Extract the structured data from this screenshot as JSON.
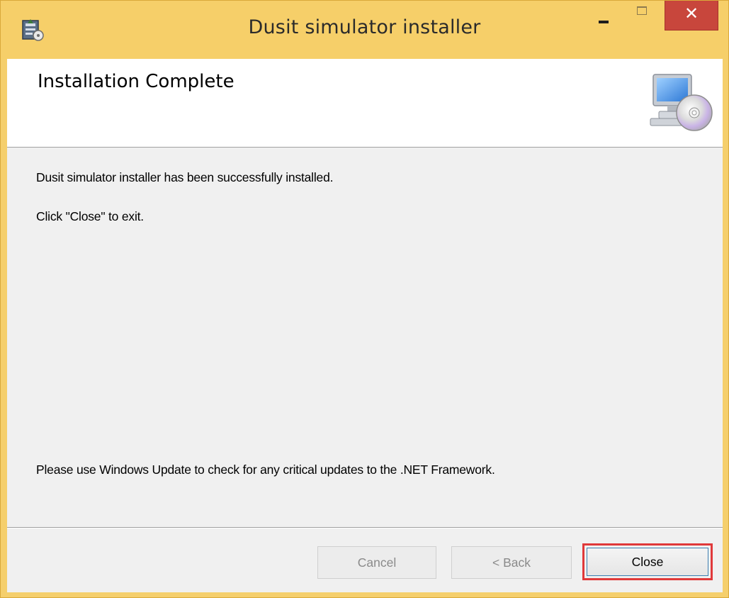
{
  "window": {
    "title": "Dusit simulator installer",
    "controls": {
      "minimize": "minimize",
      "maximize": "maximize",
      "close": "close"
    }
  },
  "header": {
    "heading": "Installation Complete",
    "graphic_icon": "computer-disc-icon"
  },
  "body": {
    "message_success": "Dusit simulator installer has been successfully installed.",
    "message_exit": "Click \"Close\" to exit.",
    "message_update": "Please use Windows Update to check for any critical updates to the .NET Framework."
  },
  "footer": {
    "cancel_label": "Cancel",
    "back_label": "< Back",
    "close_label": "Close"
  },
  "colors": {
    "titlebar": "#f6cf69",
    "close_button": "#c8463c",
    "highlight": "#e0393a",
    "client_bg": "#f0f0f0"
  }
}
